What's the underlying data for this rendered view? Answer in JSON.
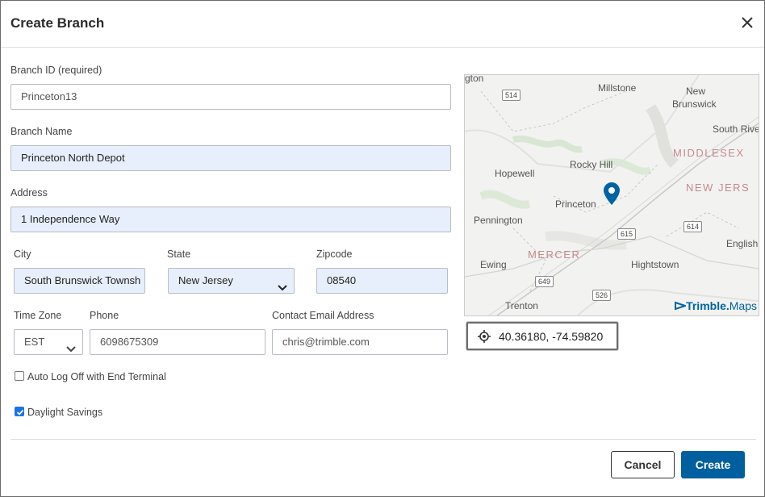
{
  "dialog": {
    "title": "Create Branch"
  },
  "form": {
    "branch_id": {
      "label": "Branch ID (required)",
      "value": "Princeton13"
    },
    "branch_name": {
      "label": "Branch Name",
      "value": "Princeton North Depot"
    },
    "address": {
      "label": "Address",
      "value": "1 Independence Way"
    },
    "city": {
      "label": "City",
      "value": "South Brunswick Townsh"
    },
    "state": {
      "label": "State",
      "value": "New Jersey"
    },
    "zipcode": {
      "label": "Zipcode",
      "value": "08540"
    },
    "time_zone": {
      "label": "Time Zone",
      "value": "EST"
    },
    "phone": {
      "label": "Phone",
      "value": "6098675309"
    },
    "email": {
      "label": "Contact Email Address",
      "value": "chris@trimble.com"
    },
    "auto_log_off": {
      "label": "Auto Log Off with End Terminal",
      "checked": false
    },
    "daylight_savings": {
      "label": "Daylight Savings",
      "checked": true
    }
  },
  "map": {
    "places": {
      "millstone": "Millstone",
      "new": "New",
      "brunswick": "Brunswick",
      "south_river": "South River",
      "middlesex": "MIDDLESEX",
      "new_jersey": "NEW JERS",
      "rocky_hill": "Rocky Hill",
      "hopewell": "Hopewell",
      "princeton": "Princeton",
      "pennington": "Pennington",
      "mercer": "MERCER",
      "hightstown": "Hightstown",
      "ewing": "Ewing",
      "trenton": "Trenton",
      "english": "English",
      "gton": "gton"
    },
    "shields": {
      "r514a": "514",
      "r615": "615",
      "r614": "614",
      "r649": "649",
      "r526": "526"
    },
    "brand": "Trimble.",
    "brand_suffix": "Maps",
    "coordinates": "40.36180, -74.59820",
    "pin_color": "#0063a3"
  },
  "buttons": {
    "cancel": "Cancel",
    "create": "Create"
  },
  "colors": {
    "primary": "#005f9e",
    "filled_input": "#e8effc"
  }
}
